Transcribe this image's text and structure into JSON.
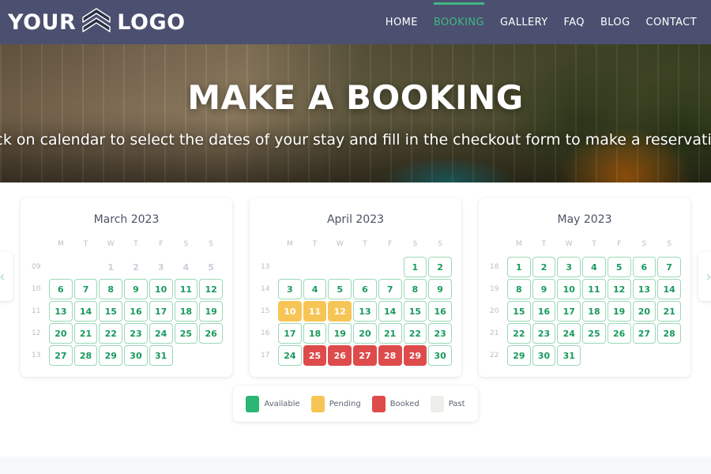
{
  "header": {
    "logo": {
      "left_text": "YOUR",
      "right_text": "LOGO",
      "mark_icon": "chevron-shield-icon"
    },
    "nav": [
      {
        "label": "HOME",
        "active": false
      },
      {
        "label": "BOOKING",
        "active": true
      },
      {
        "label": "GALLERY",
        "active": false
      },
      {
        "label": "FAQ",
        "active": false
      },
      {
        "label": "BLOG",
        "active": false
      },
      {
        "label": "CONTACT",
        "active": false
      }
    ],
    "accent_color": "#3fb882",
    "background_color": "#4b5070"
  },
  "hero": {
    "title": "MAKE A BOOKING",
    "subtitle": "Click on calendar to select the dates of your stay and fill in the checkout form to make a reservation."
  },
  "booking": {
    "prev_arrow_icon": "chevron-left-icon",
    "next_arrow_icon": "chevron-right-icon",
    "weekday_headers": [
      "M",
      "T",
      "W",
      "T",
      "F",
      "S",
      "S"
    ],
    "months": [
      {
        "title": "March 2023",
        "weeks": [
          {
            "week_no": "09",
            "days": [
              {
                "label": "",
                "state": "empty"
              },
              {
                "label": "",
                "state": "empty"
              },
              {
                "label": "1",
                "state": "past"
              },
              {
                "label": "2",
                "state": "past"
              },
              {
                "label": "3",
                "state": "past"
              },
              {
                "label": "4",
                "state": "past"
              },
              {
                "label": "5",
                "state": "past"
              }
            ]
          },
          {
            "week_no": "10",
            "days": [
              {
                "label": "6",
                "state": "available"
              },
              {
                "label": "7",
                "state": "available"
              },
              {
                "label": "8",
                "state": "available"
              },
              {
                "label": "9",
                "state": "available"
              },
              {
                "label": "10",
                "state": "available"
              },
              {
                "label": "11",
                "state": "available"
              },
              {
                "label": "12",
                "state": "available"
              }
            ]
          },
          {
            "week_no": "11",
            "days": [
              {
                "label": "13",
                "state": "available"
              },
              {
                "label": "14",
                "state": "available"
              },
              {
                "label": "15",
                "state": "available"
              },
              {
                "label": "16",
                "state": "available"
              },
              {
                "label": "17",
                "state": "available"
              },
              {
                "label": "18",
                "state": "available"
              },
              {
                "label": "19",
                "state": "available"
              }
            ]
          },
          {
            "week_no": "12",
            "days": [
              {
                "label": "20",
                "state": "available"
              },
              {
                "label": "21",
                "state": "available"
              },
              {
                "label": "22",
                "state": "available"
              },
              {
                "label": "23",
                "state": "available"
              },
              {
                "label": "24",
                "state": "available"
              },
              {
                "label": "25",
                "state": "available"
              },
              {
                "label": "26",
                "state": "available"
              }
            ]
          },
          {
            "week_no": "13",
            "days": [
              {
                "label": "27",
                "state": "available"
              },
              {
                "label": "28",
                "state": "available"
              },
              {
                "label": "29",
                "state": "available"
              },
              {
                "label": "30",
                "state": "available"
              },
              {
                "label": "31",
                "state": "available"
              },
              {
                "label": "",
                "state": "empty"
              },
              {
                "label": "",
                "state": "empty"
              }
            ]
          }
        ]
      },
      {
        "title": "April 2023",
        "weeks": [
          {
            "week_no": "13",
            "days": [
              {
                "label": "",
                "state": "empty"
              },
              {
                "label": "",
                "state": "empty"
              },
              {
                "label": "",
                "state": "empty"
              },
              {
                "label": "",
                "state": "empty"
              },
              {
                "label": "",
                "state": "empty"
              },
              {
                "label": "1",
                "state": "available"
              },
              {
                "label": "2",
                "state": "available"
              }
            ]
          },
          {
            "week_no": "14",
            "days": [
              {
                "label": "3",
                "state": "available"
              },
              {
                "label": "4",
                "state": "available"
              },
              {
                "label": "5",
                "state": "available"
              },
              {
                "label": "6",
                "state": "available"
              },
              {
                "label": "7",
                "state": "available"
              },
              {
                "label": "8",
                "state": "available"
              },
              {
                "label": "9",
                "state": "available"
              }
            ]
          },
          {
            "week_no": "15",
            "days": [
              {
                "label": "10",
                "state": "pending"
              },
              {
                "label": "11",
                "state": "pending"
              },
              {
                "label": "12",
                "state": "pending"
              },
              {
                "label": "13",
                "state": "available"
              },
              {
                "label": "14",
                "state": "available"
              },
              {
                "label": "15",
                "state": "available"
              },
              {
                "label": "16",
                "state": "available"
              }
            ]
          },
          {
            "week_no": "16",
            "days": [
              {
                "label": "17",
                "state": "available"
              },
              {
                "label": "18",
                "state": "available"
              },
              {
                "label": "19",
                "state": "available"
              },
              {
                "label": "20",
                "state": "available"
              },
              {
                "label": "21",
                "state": "available"
              },
              {
                "label": "22",
                "state": "available"
              },
              {
                "label": "23",
                "state": "available"
              }
            ]
          },
          {
            "week_no": "17",
            "days": [
              {
                "label": "24",
                "state": "available"
              },
              {
                "label": "25",
                "state": "booked"
              },
              {
                "label": "26",
                "state": "booked"
              },
              {
                "label": "27",
                "state": "booked"
              },
              {
                "label": "28",
                "state": "booked"
              },
              {
                "label": "29",
                "state": "booked"
              },
              {
                "label": "30",
                "state": "available"
              }
            ]
          }
        ]
      },
      {
        "title": "May 2023",
        "weeks": [
          {
            "week_no": "18",
            "days": [
              {
                "label": "1",
                "state": "available"
              },
              {
                "label": "2",
                "state": "available"
              },
              {
                "label": "3",
                "state": "available"
              },
              {
                "label": "4",
                "state": "available"
              },
              {
                "label": "5",
                "state": "available"
              },
              {
                "label": "6",
                "state": "available"
              },
              {
                "label": "7",
                "state": "available"
              }
            ]
          },
          {
            "week_no": "19",
            "days": [
              {
                "label": "8",
                "state": "available"
              },
              {
                "label": "9",
                "state": "available"
              },
              {
                "label": "10",
                "state": "available"
              },
              {
                "label": "11",
                "state": "available"
              },
              {
                "label": "12",
                "state": "available"
              },
              {
                "label": "13",
                "state": "available"
              },
              {
                "label": "14",
                "state": "available"
              }
            ]
          },
          {
            "week_no": "20",
            "days": [
              {
                "label": "15",
                "state": "available"
              },
              {
                "label": "16",
                "state": "available"
              },
              {
                "label": "17",
                "state": "available"
              },
              {
                "label": "18",
                "state": "available"
              },
              {
                "label": "19",
                "state": "available"
              },
              {
                "label": "20",
                "state": "available"
              },
              {
                "label": "21",
                "state": "available"
              }
            ]
          },
          {
            "week_no": "21",
            "days": [
              {
                "label": "22",
                "state": "available"
              },
              {
                "label": "23",
                "state": "available"
              },
              {
                "label": "24",
                "state": "available"
              },
              {
                "label": "25",
                "state": "available"
              },
              {
                "label": "26",
                "state": "available"
              },
              {
                "label": "27",
                "state": "available"
              },
              {
                "label": "28",
                "state": "available"
              }
            ]
          },
          {
            "week_no": "22",
            "days": [
              {
                "label": "29",
                "state": "available"
              },
              {
                "label": "30",
                "state": "available"
              },
              {
                "label": "31",
                "state": "available"
              },
              {
                "label": "",
                "state": "empty"
              },
              {
                "label": "",
                "state": "empty"
              },
              {
                "label": "",
                "state": "empty"
              },
              {
                "label": "",
                "state": "empty"
              }
            ]
          }
        ]
      }
    ],
    "legend": [
      {
        "label": "Available",
        "color": "#2bb673"
      },
      {
        "label": "Pending",
        "color": "#f6c555"
      },
      {
        "label": "Booked",
        "color": "#dd4b4b"
      },
      {
        "label": "Past",
        "color": "#eeeeea"
      }
    ]
  }
}
